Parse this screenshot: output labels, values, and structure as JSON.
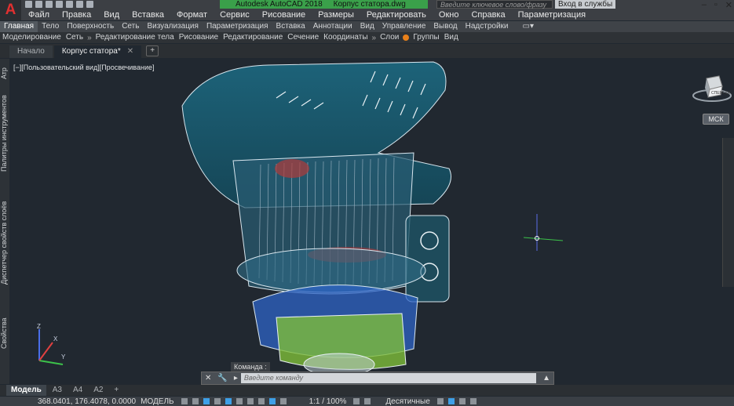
{
  "app": {
    "logo_letter": "A",
    "title": "Autodesk AutoCAD 2018",
    "filename": "Корпус статора.dwg"
  },
  "search": {
    "placeholder": "Введите ключевое слово/фразу"
  },
  "signin": {
    "label": "Вход в службы"
  },
  "menu": [
    "Файл",
    "Правка",
    "Вид",
    "Вставка",
    "Формат",
    "Сервис",
    "Рисование",
    "Размеры",
    "Редактировать",
    "Окно",
    "Справка",
    "Параметризация"
  ],
  "ribbon_tabs": [
    {
      "label": "Главная",
      "active": true
    },
    {
      "label": "Тело"
    },
    {
      "label": "Поверхность"
    },
    {
      "label": "Сеть"
    },
    {
      "label": "Визуализация"
    },
    {
      "label": "Параметризация"
    },
    {
      "label": "Вставка"
    },
    {
      "label": "Аннотации"
    },
    {
      "label": "Вид"
    },
    {
      "label": "Управление"
    },
    {
      "label": "Вывод"
    },
    {
      "label": "Надстройки"
    }
  ],
  "ribbon_panels": [
    "Моделирование",
    "Сеть",
    "Редактирование тела",
    "Рисование",
    "Редактирование",
    "Сечение",
    "Координаты",
    "Слои",
    "Группы",
    "Вид"
  ],
  "file_tabs": [
    {
      "label": "Начало",
      "active": false
    },
    {
      "label": "Корпус статора*",
      "active": true
    }
  ],
  "viewport": {
    "label": "[−][Пользовательский вид][Просвечивание]"
  },
  "viewcube": {
    "face_label": "СПЕРЕДИ",
    "ucs_label": "МСК"
  },
  "left_palettes": [
    "Свойства",
    "Диспетчер свойств слоёв",
    "Палитры инструментов",
    "Атр"
  ],
  "command": {
    "label": "Команда :",
    "placeholder": "Введите команду"
  },
  "layout_tabs": [
    {
      "label": "Модель",
      "active": true
    },
    {
      "label": "A3"
    },
    {
      "label": "A4"
    },
    {
      "label": "A2"
    }
  ],
  "status": {
    "coords": "368.0401, 176.4078, 0.0000",
    "mode": "МОДЕЛЬ",
    "scale": "1:1 / 100%",
    "units": "Десятичные"
  },
  "colors": {
    "accent_blue": "#3ea0e8",
    "title_green": "#3aa04a",
    "logo_red": "#e03030"
  }
}
